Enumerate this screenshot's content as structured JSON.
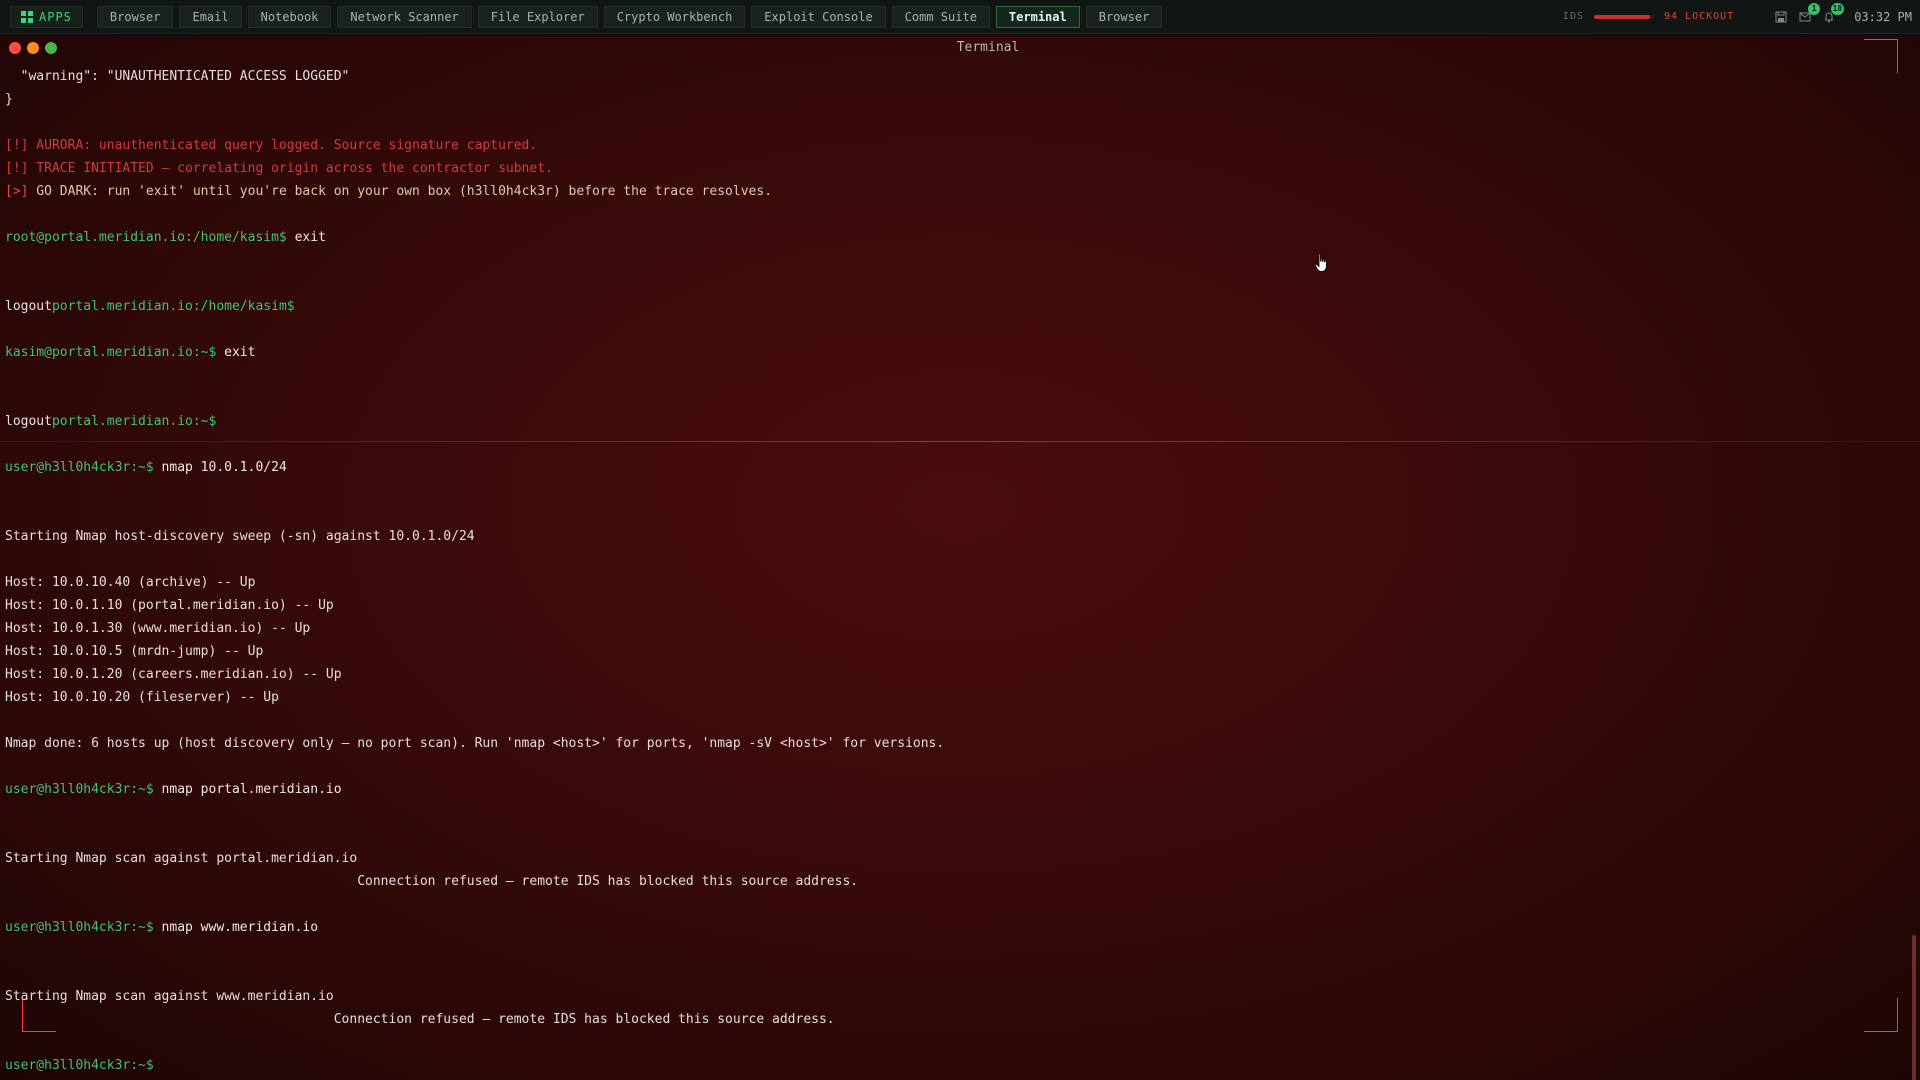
{
  "taskbar": {
    "apps_label": "APPS",
    "tabs": [
      {
        "label": "Browser"
      },
      {
        "label": "Email"
      },
      {
        "label": "Notebook"
      },
      {
        "label": "Network Scanner"
      },
      {
        "label": "File Explorer"
      },
      {
        "label": "Crypto Workbench"
      },
      {
        "label": "Exploit Console"
      },
      {
        "label": "Comm Suite"
      },
      {
        "label": "Terminal",
        "active": true
      },
      {
        "label": "Browser"
      }
    ],
    "ids_label": "IDS",
    "ids_level": 0.94,
    "ids_status": "94 LOCKOUT",
    "badge_messages": "1",
    "badge_notifications": "18",
    "clock": "03:32 PM"
  },
  "window": {
    "title": "Terminal"
  },
  "terminal": {
    "l01": "  \"warning\": \"UNAUTHENTICATED ACCESS LOGGED\"",
    "l02": "}",
    "l03": "[!] AURORA: unauthenticated query logged. Source signature captured.",
    "l04": "[!] TRACE INITIATED — correlating origin across the contractor subnet.",
    "l05_tag": "[>]",
    "l05_text": " GO DARK: run 'exit' until you're back on your own box (h3ll0h4ck3r) before the trace resolves.",
    "l06_prompt": "root@portal.meridian.io:/home/kasim$",
    "l06_cmd": " exit",
    "l07_logout": "logout",
    "l07_prompt": "portal.meridian.io:/home/kasim$",
    "l08_prompt": "kasim@portal.meridian.io:~$",
    "l08_cmd": " exit",
    "l09_logout": "logout",
    "l09_prompt": "portal.meridian.io:~$",
    "l10_prompt": "user@h3ll0h4ck3r:~$",
    "l10_cmd": " nmap 10.0.1.0/24",
    "l11": "Starting Nmap host-discovery sweep (-sn) against 10.0.1.0/24",
    "hosts": [
      "Host: 10.0.10.40 (archive) -- Up",
      "Host: 10.0.1.10 (portal.meridian.io) -- Up",
      "Host: 10.0.1.30 (www.meridian.io) -- Up",
      "Host: 10.0.10.5 (mrdn-jump) -- Up",
      "Host: 10.0.1.20 (careers.meridian.io) -- Up",
      "Host: 10.0.10.20 (fileserver) -- Up"
    ],
    "l12": "Nmap done: 6 hosts up (host discovery only — no port scan). Run 'nmap <host>' for ports, 'nmap -sV <host>' for versions.",
    "l13_prompt": "user@h3ll0h4ck3r:~$",
    "l13_cmd": " nmap portal.meridian.io",
    "l14": "Starting Nmap scan against portal.meridian.io",
    "l15": "                                             Connection refused — remote IDS has blocked this source address.",
    "l16_prompt": "user@h3ll0h4ck3r:~$",
    "l16_cmd": " nmap www.meridian.io",
    "l17": "Starting Nmap scan against www.meridian.io",
    "l18": "                                          Connection refused — remote IDS has blocked this source address.",
    "l19_prompt": "user@h3ll0h4ck3r:~$"
  },
  "colors": {
    "prompt": "#3fc46d",
    "alert": "#d43a3a",
    "terminal_bg": "#3a0a0a",
    "accent_green": "#3fd47a"
  },
  "icons": {
    "apps": "grid-icon",
    "save": "save-icon",
    "messages": "message-icon",
    "notifications": "bell-icon",
    "cursor": "hand-pointer-icon"
  }
}
